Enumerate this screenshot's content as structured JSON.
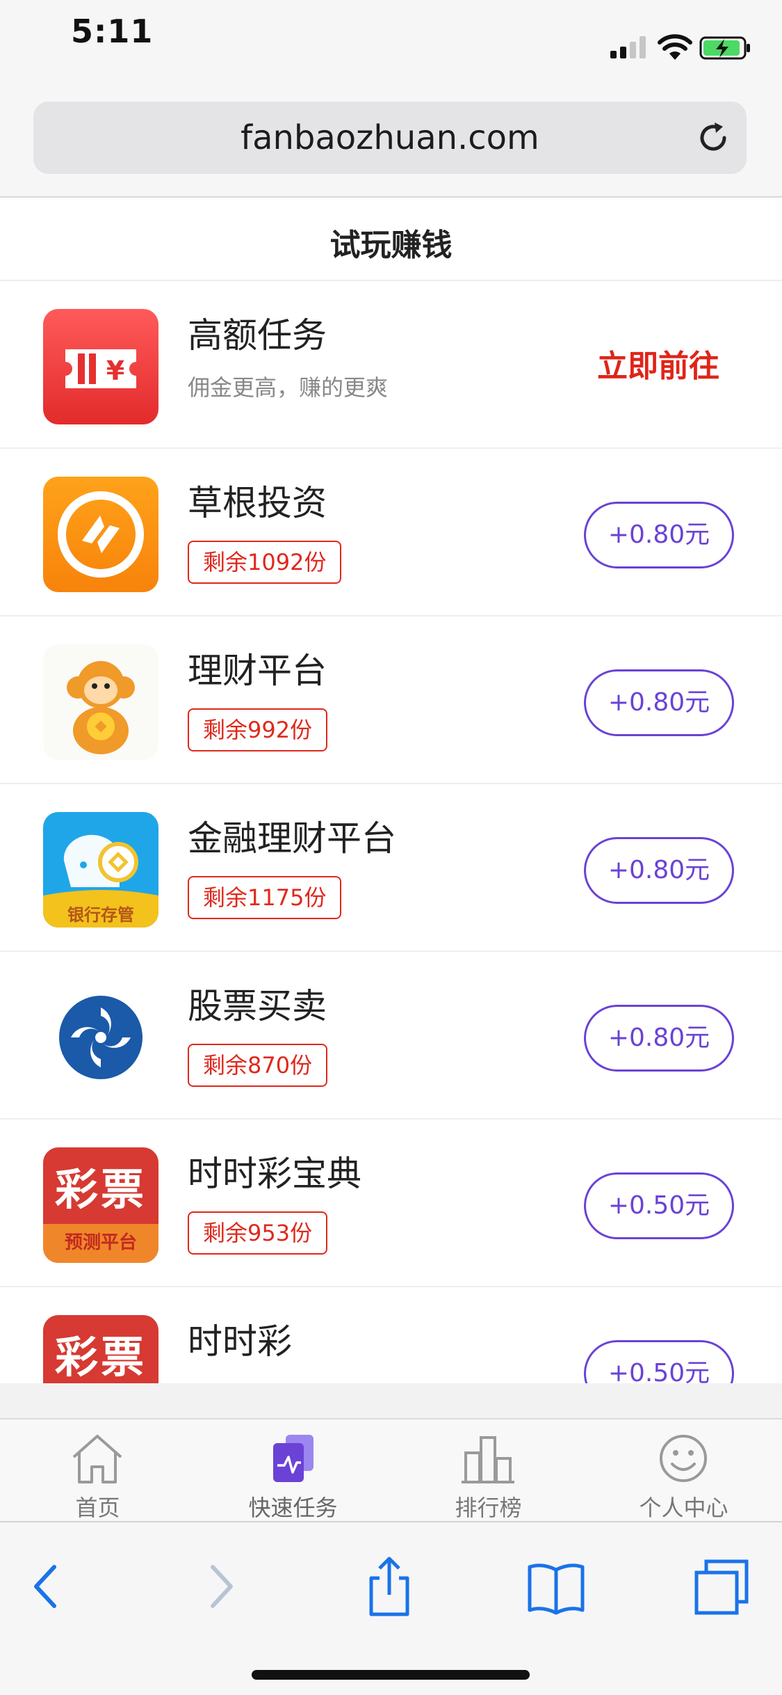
{
  "status": {
    "time": "5:11"
  },
  "browser": {
    "url": "fanbaozhuan.com"
  },
  "page": {
    "title": "试玩赚钱"
  },
  "featured": {
    "name": "高额任务",
    "subtitle": "佣金更高，赚的更爽",
    "action": "立即前往"
  },
  "tasks": [
    {
      "name": "草根投资",
      "remaining": "剩余1092份",
      "reward": "+0.80元",
      "icon": "chart-coin-icon"
    },
    {
      "name": "理财平台",
      "remaining": "剩余992份",
      "reward": "+0.80元",
      "icon": "monkey-icon"
    },
    {
      "name": "金融理财平台",
      "remaining": "剩余1175份",
      "reward": "+0.80元",
      "icon": "bank-elephant-icon",
      "icon_text": "银行存管"
    },
    {
      "name": "股票买卖",
      "remaining": "剩余870份",
      "reward": "+0.80元",
      "icon": "swirl-logo-icon"
    },
    {
      "name": "时时彩宝典",
      "remaining": "剩余953份",
      "reward": "+0.50元",
      "icon": "lottery-icon",
      "icon_text": "彩票",
      "icon_subtext": "预测平台"
    },
    {
      "name": "时时彩",
      "remaining": "",
      "reward": "+0.50元",
      "icon": "lottery-icon",
      "icon_text": "彩票"
    }
  ],
  "tabbar": [
    {
      "label": "首页",
      "icon": "home-icon",
      "active": false
    },
    {
      "label": "快速任务",
      "icon": "task-icon",
      "active": true
    },
    {
      "label": "排行榜",
      "icon": "ranking-icon",
      "active": false
    },
    {
      "label": "个人中心",
      "icon": "profile-icon",
      "active": false
    }
  ],
  "colors": {
    "accent": "#6a42d6",
    "red": "#e0281d",
    "orange": "#f5900f"
  }
}
